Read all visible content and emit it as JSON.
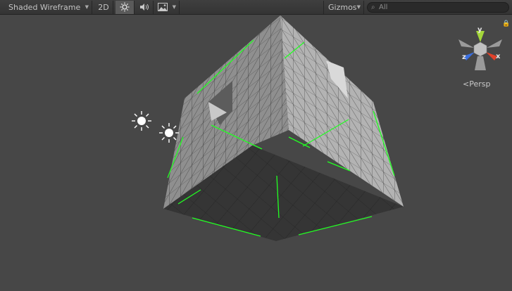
{
  "toolbar": {
    "draw_mode": "Shaded Wireframe",
    "mode_2d": "2D",
    "lighting_icon": "sun-icon",
    "audio_icon": "speaker-icon",
    "effects_icon": "image-icon",
    "gizmos_label": "Gizmos",
    "search_placeholder": "All",
    "search_value": ""
  },
  "scene": {
    "projection_label": "Persp",
    "gizmo_axes": {
      "x": "x",
      "y": "y",
      "z": "z"
    },
    "colors": {
      "background": "#474747",
      "toolbar": "#383838",
      "axis_x": "#e0412a",
      "axis_y": "#a4d63a",
      "axis_z": "#3a6fe0",
      "highlight_edge": "#22ff22"
    },
    "light_icons": [
      "sun-icon",
      "sun-icon"
    ]
  }
}
